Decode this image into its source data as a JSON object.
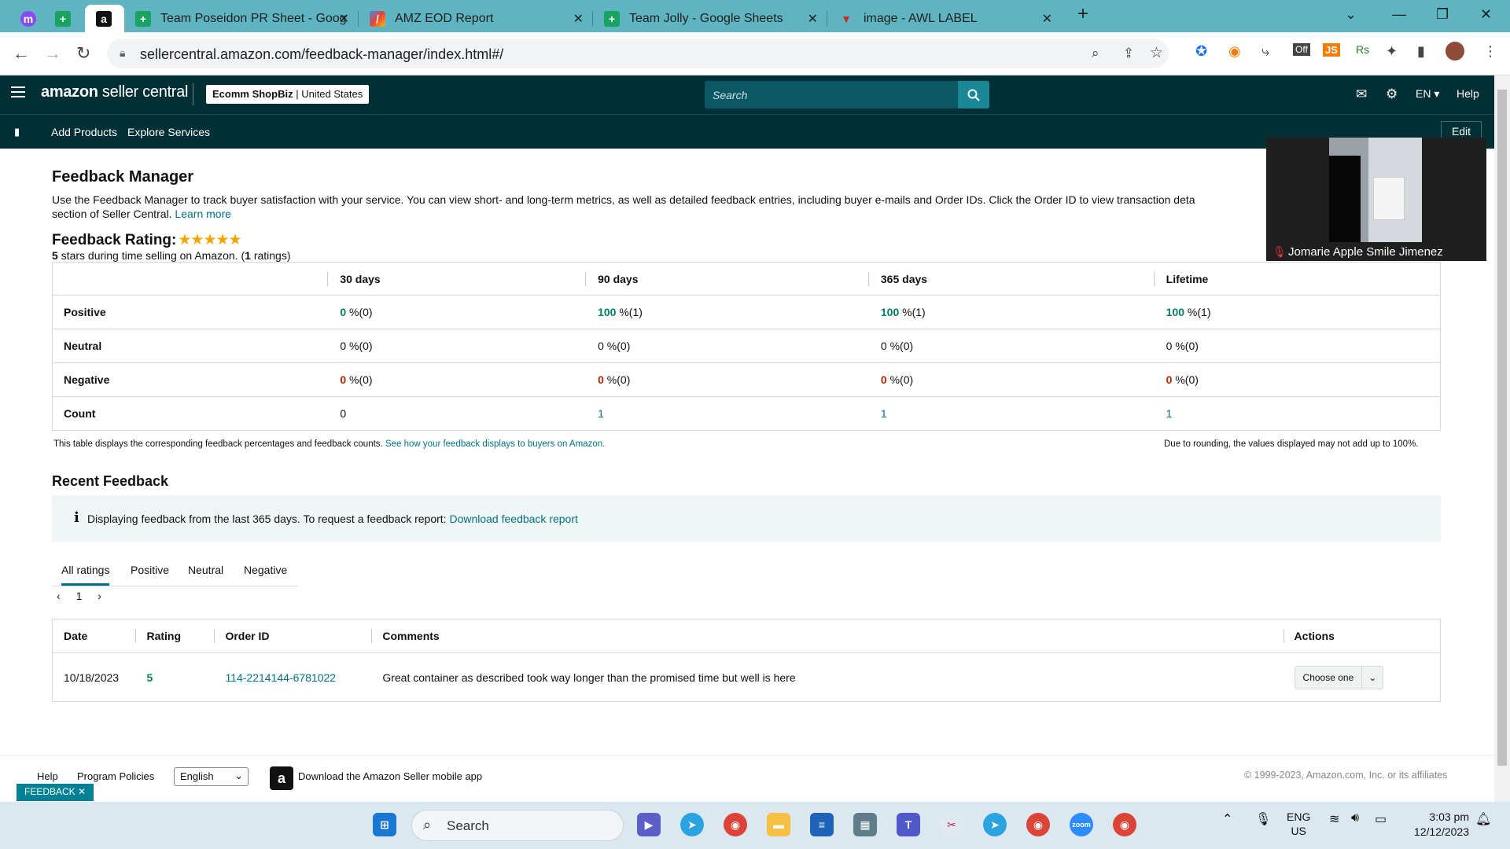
{
  "browser": {
    "tabs": [
      {
        "title": "",
        "icon": "messenger-icon"
      },
      {
        "title": "",
        "icon": "google-sheets-icon"
      },
      {
        "title": "",
        "icon": "amazon-icon",
        "active": true
      },
      {
        "title": "Team Poseidon PR Sheet - Goog",
        "icon": "google-sheets-icon"
      },
      {
        "title": "AMZ EOD Report",
        "icon": "report-icon"
      },
      {
        "title": "Team Jolly - Google Sheets",
        "icon": "google-sheets-icon"
      },
      {
        "title": "image - AWL LABEL",
        "icon": "awl-icon"
      }
    ],
    "url": "sellercentral.amazon.com/feedback-manager/index.html#/"
  },
  "header": {
    "logo_main": "amazon",
    "logo_sub": " seller central",
    "store_name": "Ecomm ShopBiz",
    "store_region": "United States",
    "search_placeholder": "Search",
    "language": "EN",
    "help": "Help",
    "nav": {
      "add_products": "Add Products",
      "explore_services": "Explore Services",
      "edit": "Edit"
    }
  },
  "page": {
    "title": "Feedback Manager",
    "description_1": "Use the Feedback Manager to track buyer satisfaction with your service. You can view short- and long-term metrics, as well as detailed feedback entries, including buyer e-mails and Order IDs. Click the Order ID to view transaction deta",
    "description_2": "section of Seller Central.",
    "learn_more": "Learn more",
    "rating_title": "Feedback Rating:",
    "rating_stars": 5,
    "rating_sub_value": "5",
    "rating_sub_mid": " stars during time selling on Amazon. (",
    "rating_sub_count": "1",
    "rating_sub_end": " ratings)"
  },
  "metrics": {
    "columns": [
      "",
      "30 days",
      "90 days",
      "365 days",
      "Lifetime"
    ],
    "rows": [
      {
        "label": "Positive",
        "cells": [
          {
            "v": "0",
            "p": " %(0)",
            "c": "g"
          },
          {
            "v": "100",
            "p": " %(1)",
            "c": "g"
          },
          {
            "v": "100",
            "p": " %(1)",
            "c": "g"
          },
          {
            "v": "100",
            "p": " %(1)",
            "c": "g"
          }
        ]
      },
      {
        "label": "Neutral",
        "cells": [
          {
            "v": "0",
            "p": " %(0)",
            "c": ""
          },
          {
            "v": "0",
            "p": " %(0)",
            "c": ""
          },
          {
            "v": "0",
            "p": " %(0)",
            "c": ""
          },
          {
            "v": "0",
            "p": " %(0)",
            "c": ""
          }
        ]
      },
      {
        "label": "Negative",
        "cells": [
          {
            "v": "0",
            "p": " %(0)",
            "c": "r"
          },
          {
            "v": "0",
            "p": " %(0)",
            "c": "r"
          },
          {
            "v": "0",
            "p": " %(0)",
            "c": "r"
          },
          {
            "v": "0",
            "p": " %(0)",
            "c": "r"
          }
        ]
      },
      {
        "label": "Count",
        "cells": [
          {
            "v": "0",
            "p": "",
            "c": ""
          },
          {
            "v": "1",
            "p": "",
            "c": ""
          },
          {
            "v": "1",
            "p": "",
            "c": ""
          },
          {
            "v": "1",
            "p": "",
            "c": ""
          }
        ]
      }
    ],
    "note": "This table displays the corresponding feedback percentages and feedback counts.",
    "note_link": "See how your feedback displays to buyers on Amazon.",
    "rounding_note": "Due to rounding, the values displayed may not add up to 100%."
  },
  "recent": {
    "title": "Recent Feedback",
    "info_text": "Displaying feedback from the last 365 days. To request a feedback report:",
    "info_link": "Download feedback report",
    "filters": [
      "All ratings",
      "Positive",
      "Neutral",
      "Negative"
    ],
    "page_number": "1",
    "columns": [
      "Date",
      "Rating",
      "Order ID",
      "Comments",
      "Actions"
    ],
    "rows": [
      {
        "date": "10/18/2023",
        "rating": "5",
        "order_id": "114-2214144-6781022",
        "comment": "Great container as described took way longer than the promised time but well is here",
        "action": "Choose one"
      }
    ]
  },
  "footer": {
    "help": "Help",
    "program_policies": "Program Policies",
    "language": "English",
    "download_app": "Download the Amazon Seller mobile app",
    "copyright": "© 1999-2023, Amazon.com, Inc. or its affiliates",
    "feedback_tab": "FEEDBACK"
  },
  "video": {
    "participant": "Jomarie Apple Smile Jimenez"
  },
  "taskbar": {
    "search": "Search",
    "lang_top": "ENG",
    "lang_bottom": "US",
    "time": "3:03 pm",
    "date": "12/12/2023"
  },
  "colors": {
    "header_bg": "#002f36",
    "link": "#007185",
    "positive": "#067d62",
    "negative": "#b12704",
    "star": "#f0a500"
  }
}
